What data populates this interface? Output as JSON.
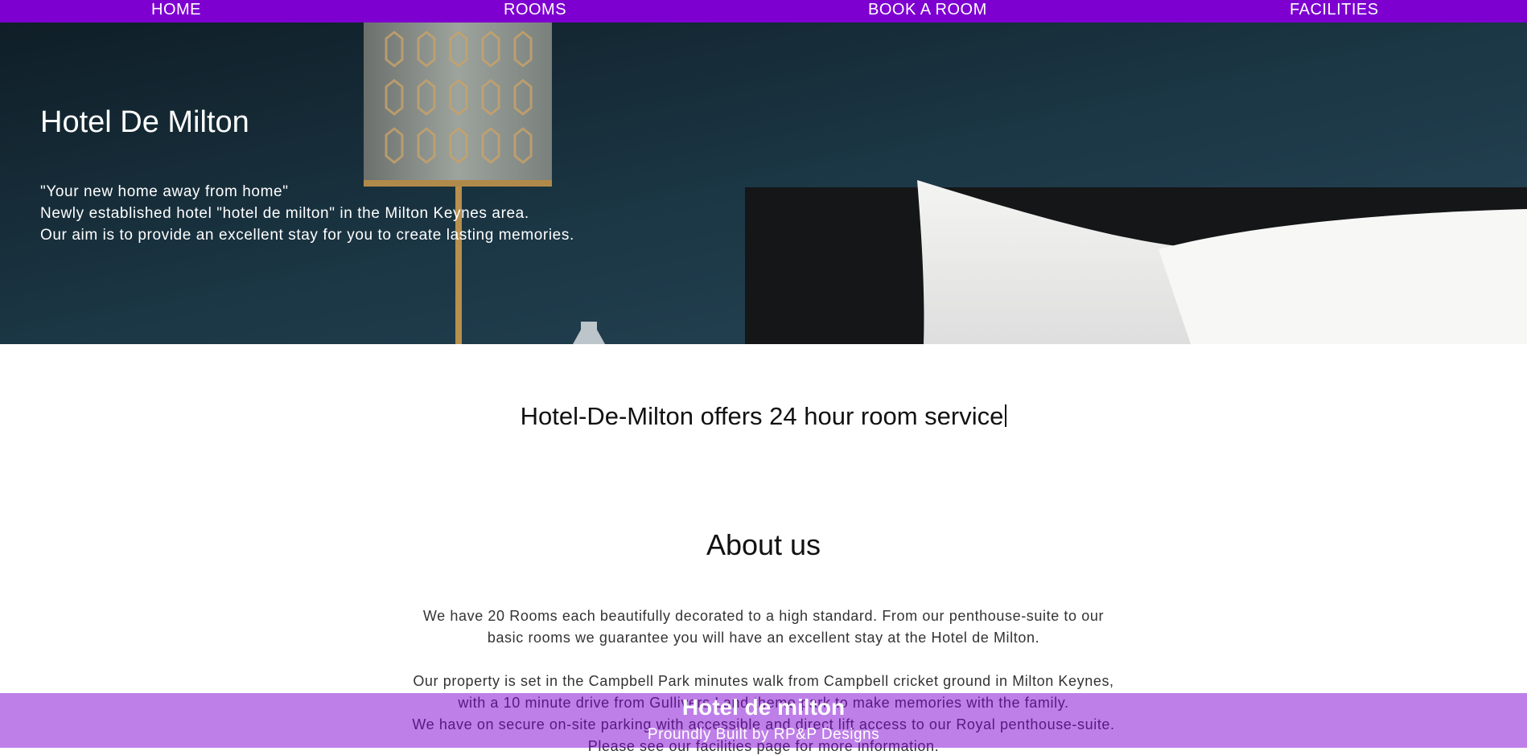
{
  "nav": {
    "items": [
      {
        "label": "HOME"
      },
      {
        "label": "ROOMS"
      },
      {
        "label": "BOOK A ROOM"
      },
      {
        "label": "FACILITIES"
      }
    ]
  },
  "hero": {
    "title": "Hotel De Milton",
    "lines": [
      "\"Your new home away from home\"",
      "Newly established hotel \"hotel de milton\" in the Milton Keynes area.",
      "Our aim is to provide an excellent stay for you to create lasting memories."
    ]
  },
  "typing_text": "Hotel-De-Milton offers 24 hour room service",
  "about": {
    "heading": "About us",
    "lines": [
      "We have 20 Rooms each beautifully decorated to a high standard. From our penthouse-suite to our",
      "basic rooms we guarantee you will have an excellent stay at the Hotel de Milton.",
      "Our property is set in the Campbell Park minutes walk from Campbell cricket ground in Milton Keynes,",
      "with a 10 minute drive from Gullivers Land theme park to make memories with the family.",
      "We have on secure on-site parking with accessible and direct lift access to our Royal penthouse-suite.",
      "Please see our facilities page for more information."
    ]
  },
  "footer": {
    "title": "Hotel de milton",
    "credit": "Proundly Built by RP&P Designs"
  },
  "colors": {
    "nav_bg": "#7d00d1",
    "footer_bg": "rgba(125,0,209,0.5)",
    "hero_wall": "#1b3340"
  }
}
